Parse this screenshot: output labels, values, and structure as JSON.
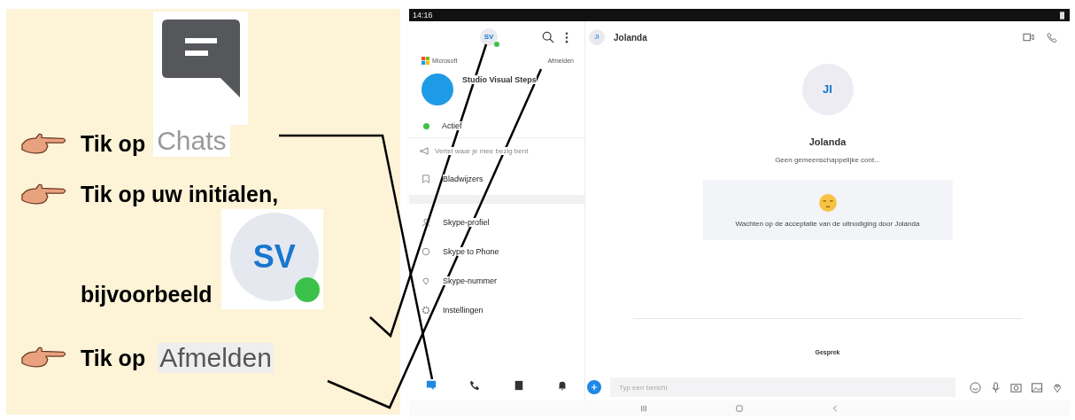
{
  "steps": [
    {
      "kind": "chats",
      "text": "Tik op",
      "target": "Chats"
    },
    {
      "kind": "initials",
      "text": "Tik op uw initialen,",
      "example": "bijvoorbeeld",
      "initials": "SV"
    },
    {
      "kind": "word",
      "text": "Tik op",
      "target": "Afmelden"
    }
  ],
  "status_bar": {
    "time": "14:16"
  },
  "drawer": {
    "avatar": "SV",
    "brand": "Microsoft",
    "sign_out": "Afmelden",
    "profile_name": "Studio Visual Steps",
    "status": "Actief",
    "mood_placeholder": "Vertel waar je mee bezig bent",
    "items": [
      {
        "kind": "bookmark",
        "label": "Bladwijzers"
      },
      {
        "kind": "section"
      },
      {
        "kind": "person",
        "label": "Skype-profiel"
      },
      {
        "kind": "globe",
        "label": "Skype to Phone"
      },
      {
        "kind": "pin",
        "label": "Skype-nummer"
      },
      {
        "kind": "gear",
        "label": "Instellingen"
      }
    ]
  },
  "nav": [
    {
      "kind": "chat",
      "selected": true
    },
    {
      "kind": "phone",
      "selected": false
    },
    {
      "kind": "contacts",
      "selected": false
    },
    {
      "kind": "bell",
      "selected": false
    }
  ],
  "chat": {
    "header_initials": "JI",
    "header_name": "Jolanda",
    "contact_initials": "JI",
    "contact_name": "Jolanda",
    "info": "Geen gemeenschappelijke cont...",
    "notice": "Wachten op de acceptatie van de uitnodiging door Jolanda",
    "event": "Gesprek",
    "compose_placeholder": "Typ een bericht"
  }
}
